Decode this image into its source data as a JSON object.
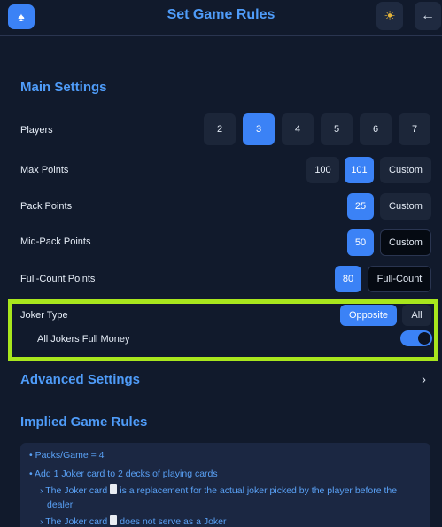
{
  "header": {
    "title": "Set Game Rules",
    "logo_icon": "spade-icon",
    "theme_icon": "sun-icon",
    "back_icon": "arrow-left-icon"
  },
  "main_settings": {
    "title": "Main Settings",
    "players": {
      "label": "Players",
      "options": [
        "2",
        "3",
        "4",
        "5",
        "6",
        "7"
      ],
      "selected": "3"
    },
    "max_points": {
      "label": "Max Points",
      "options": [
        "100",
        "101",
        "Custom"
      ],
      "selected": "101"
    },
    "pack_points": {
      "label": "Pack Points",
      "options": [
        "25",
        "Custom"
      ],
      "selected": "25"
    },
    "mid_pack_points": {
      "label": "Mid-Pack Points",
      "options": [
        "50",
        "Custom"
      ],
      "selected": "50"
    },
    "full_count_points": {
      "label": "Full-Count Points",
      "options": [
        "80",
        "Full-Count"
      ],
      "selected": "80"
    },
    "joker_type": {
      "label": "Joker Type",
      "options": [
        "Opposite",
        "All"
      ],
      "selected": "Opposite"
    },
    "all_jokers_full_money": {
      "label": "All Jokers Full Money",
      "enabled": true
    }
  },
  "advanced_settings": {
    "title": "Advanced Settings"
  },
  "implied_rules": {
    "title": "Implied Game Rules",
    "items": [
      "• Packs/Game = 4",
      "• Add 1 Joker card to 2 decks of playing cards",
      "› The Joker card",
      "is a replacement for the actual joker picked by the player before the",
      "dealer",
      "› The Joker card",
      "does not serve as a Joker"
    ]
  },
  "colors": {
    "background": "#111a2c",
    "accent": "#3b82f6",
    "title_blue": "#4f9cf9",
    "highlight": "#a8e61d"
  }
}
